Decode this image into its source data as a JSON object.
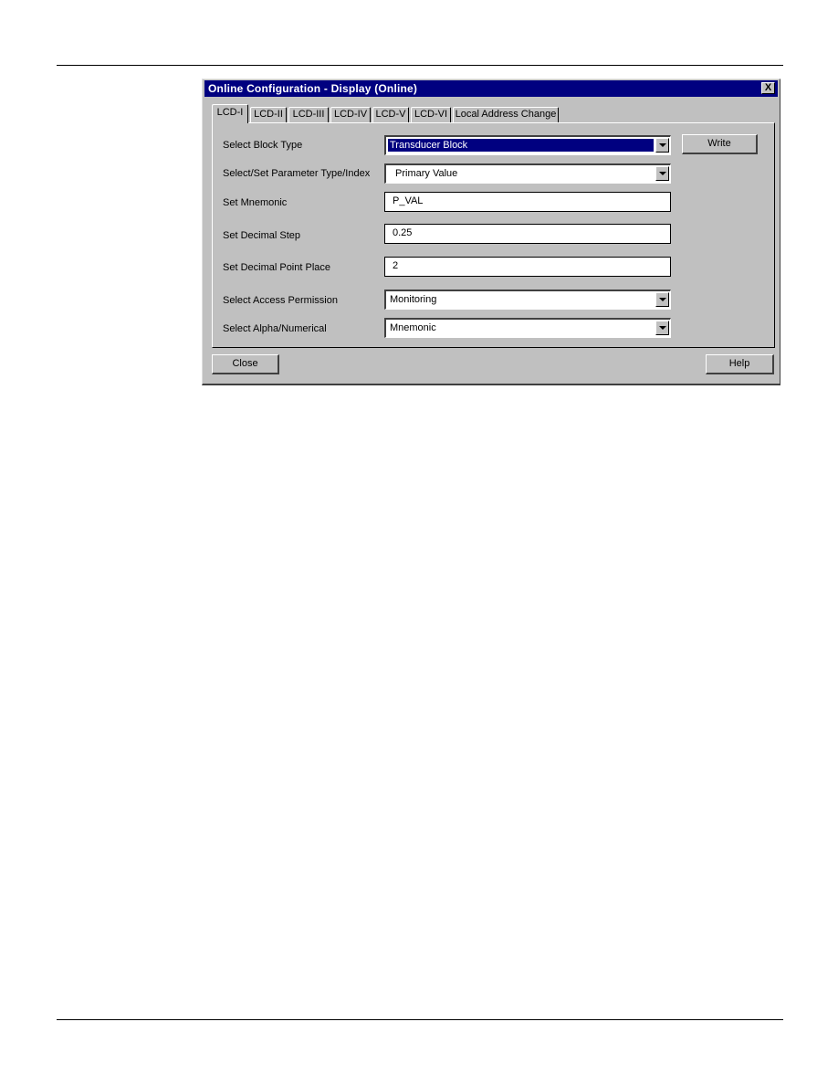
{
  "dialog": {
    "title": "Online Configuration - Display  (Online)",
    "close_glyph": "X"
  },
  "tabs": [
    {
      "label": "LCD-I",
      "active": true
    },
    {
      "label": "LCD-II"
    },
    {
      "label": "LCD-III"
    },
    {
      "label": "LCD-IV"
    },
    {
      "label": "LCD-V"
    },
    {
      "label": "LCD-VI"
    },
    {
      "label": "Local Address Change"
    }
  ],
  "form": {
    "block_type": {
      "label": "Select Block Type",
      "value": "Transducer Block"
    },
    "parameter": {
      "label": "Select/Set Parameter Type/Index",
      "value": "Primary Value"
    },
    "mnemonic": {
      "label": "Set Mnemonic",
      "value": "P_VAL"
    },
    "decimal_step": {
      "label": "Set Decimal Step",
      "value": "0.25"
    },
    "decimal_point": {
      "label": "Set Decimal Point Place",
      "value": "2"
    },
    "access": {
      "label": "Select Access Permission",
      "value": "Monitoring"
    },
    "alpha": {
      "label": "Select Alpha/Numerical",
      "value": "Mnemonic"
    }
  },
  "buttons": {
    "write": "Write",
    "close": "Close",
    "help": "Help"
  }
}
